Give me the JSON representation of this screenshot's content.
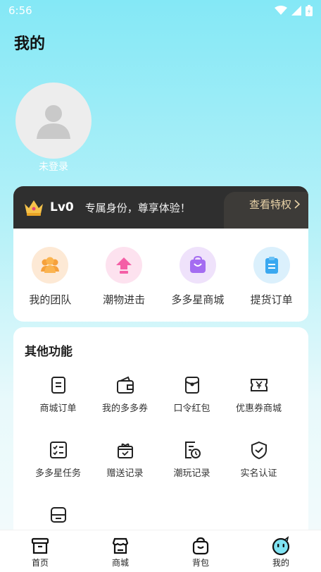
{
  "status_bar": {
    "time": "6:56"
  },
  "header": {
    "title": "我的"
  },
  "profile": {
    "login_label": "未登录"
  },
  "vip": {
    "level": "Lv0",
    "description": "专属身份，尊享体验！",
    "privilege_link": "查看特权",
    "colors": {
      "bar": "#2f2f2f",
      "link": "#e9d3a8"
    }
  },
  "quick_actions": [
    {
      "label": "我的团队",
      "icon": "team-icon",
      "bg": "#fde9d5"
    },
    {
      "label": "潮物进击",
      "icon": "upload-icon",
      "bg": "#fde2ef"
    },
    {
      "label": "多多星商城",
      "icon": "shopping-bag-icon",
      "bg": "#efe2fb"
    },
    {
      "label": "提货订单",
      "icon": "clipboard-icon",
      "bg": "#dbf0fc"
    }
  ],
  "functions": {
    "title": "其他功能",
    "items": [
      {
        "label": "商城订单",
        "icon": "order-doc-icon"
      },
      {
        "label": "我的多多券",
        "icon": "wallet-icon"
      },
      {
        "label": "口令红包",
        "icon": "red-packet-icon"
      },
      {
        "label": "优惠券商城",
        "icon": "yen-coupon-icon"
      },
      {
        "label": "多多星任务",
        "icon": "checklist-icon"
      },
      {
        "label": "赠送记录",
        "icon": "gift-icon"
      },
      {
        "label": "潮玩记录",
        "icon": "history-doc-icon"
      },
      {
        "label": "实名认证",
        "icon": "shield-check-icon"
      },
      {
        "label": "",
        "icon": "tray-icon"
      }
    ]
  },
  "bottom_nav": [
    {
      "label": "首页",
      "icon": "home-box-icon",
      "active": false
    },
    {
      "label": "商城",
      "icon": "store-icon",
      "active": false
    },
    {
      "label": "背包",
      "icon": "bag-icon",
      "active": false
    },
    {
      "label": "我的",
      "icon": "face-icon",
      "active": true
    }
  ]
}
